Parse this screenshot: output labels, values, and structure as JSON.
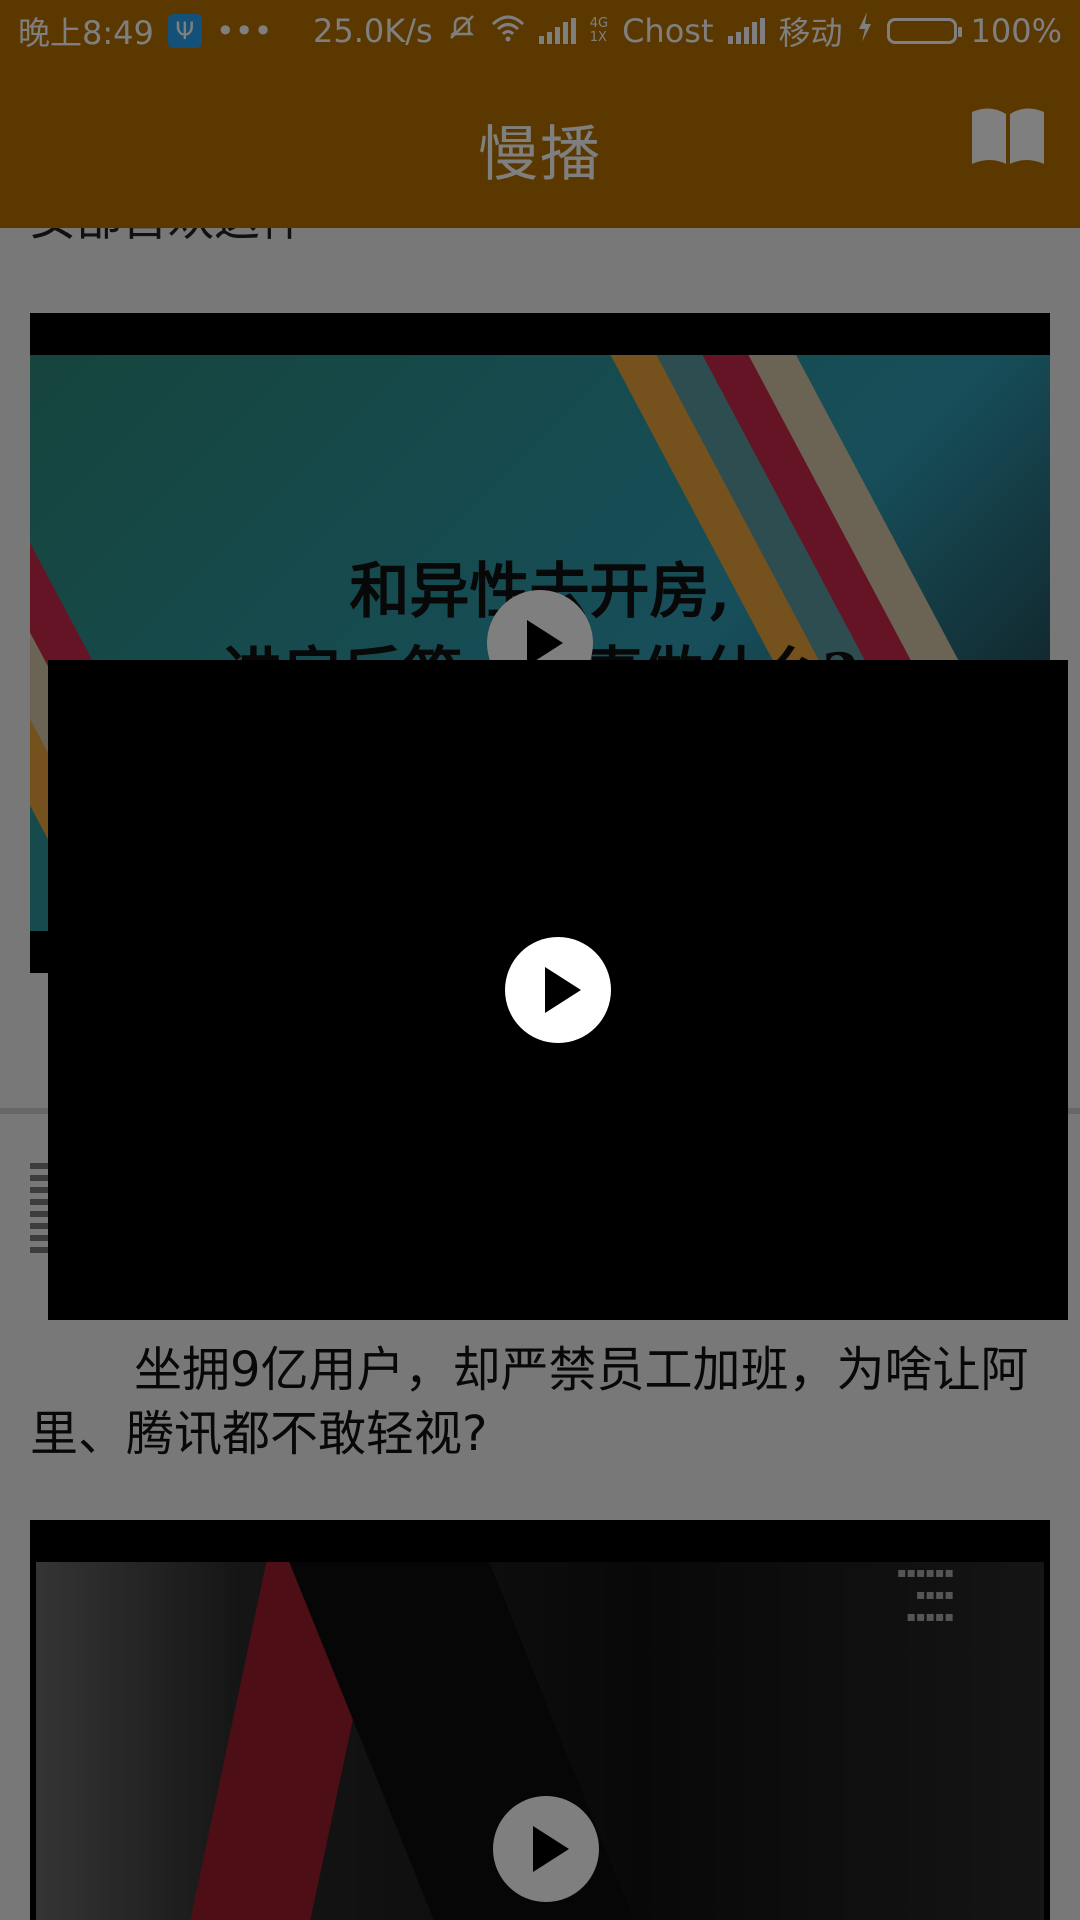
{
  "status_bar": {
    "time": "晚上8:49",
    "usb_icon": "usb-icon",
    "more": "•••",
    "speed": "25.0K/s",
    "net_type_top": "4G",
    "net_type_bottom": "1X",
    "carrier1": "Chost",
    "carrier2": "移动",
    "battery": "100%",
    "battery_color": "#39e01a"
  },
  "app_bar": {
    "title": "慢播",
    "background": "#b57000",
    "right_icon": "book-icon"
  },
  "feed": {
    "partial_title": "女部首欢这件",
    "video1": {
      "thumb_line1": "和异性去开房,",
      "thumb_line2": "进房后第一件事做什么?"
    },
    "item2": {
      "headline": "坐拥9亿用户，却严禁员工加班，为啥让阿里、腾讯都不敢轻视?"
    }
  },
  "floating_player": {
    "play_icon": "play-icon"
  }
}
